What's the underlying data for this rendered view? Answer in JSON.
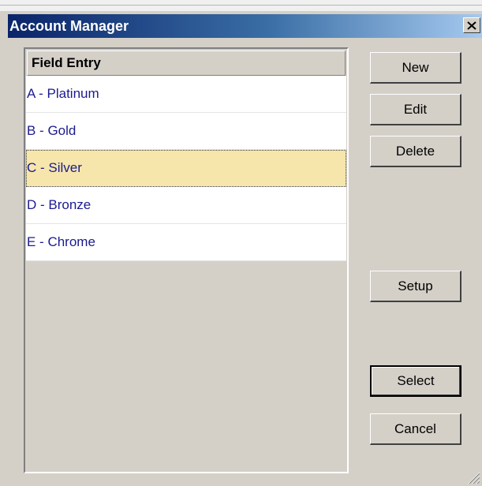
{
  "window": {
    "title": "Account Manager"
  },
  "list": {
    "header": "Field Entry",
    "items": [
      {
        "label": "A - Platinum"
      },
      {
        "label": "B - Gold"
      },
      {
        "label": "C - Silver",
        "selected": true
      },
      {
        "label": "D - Bronze"
      },
      {
        "label": "E - Chrome"
      }
    ]
  },
  "buttons": {
    "new": "New",
    "edit": "Edit",
    "delete": "Delete",
    "setup": "Setup",
    "select": "Select",
    "cancel": "Cancel"
  },
  "icons": {
    "close": "close-icon",
    "resize": "resize-grip-icon"
  },
  "colors": {
    "selection": "#f6e6ab",
    "item_text": "#1b1b8f",
    "titlebar_start": "#0a246a",
    "titlebar_end": "#a6caf0"
  }
}
